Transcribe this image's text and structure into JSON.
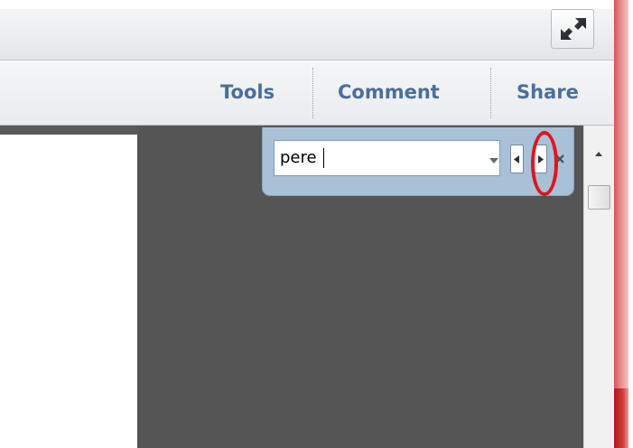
{
  "toolbar": {
    "tabs": [
      {
        "label": "Tools"
      },
      {
        "label": "Comment"
      },
      {
        "label": "Share"
      }
    ]
  },
  "find": {
    "query": "pere",
    "icons": {
      "dropdown": "chevron-down-icon",
      "previous": "triangle-left-icon",
      "next": "triangle-right-icon",
      "close": "close-icon"
    }
  },
  "window": {
    "maximize_icon": "expand-icon"
  },
  "scrollbar": {
    "up_icon": "arrow-up-icon"
  },
  "colors": {
    "toolbar_text": "#4a6f9a",
    "find_bar": "#a9c1d6",
    "canvas": "#555555",
    "highlight_ring": "#e0141e",
    "window_edge": "#d65555"
  }
}
